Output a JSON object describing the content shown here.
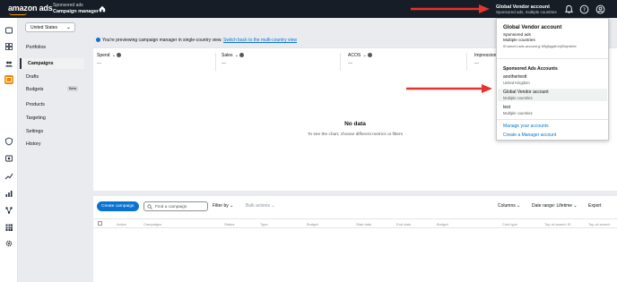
{
  "topbar": {
    "logo": "amazon ads",
    "product_sub": "Sponsored ads",
    "product_main": "Campaign manager",
    "account_name": "Global Vendor account",
    "account_meta": "Sponsored ads, multiple countries"
  },
  "country_selector": {
    "value": "United States"
  },
  "nav": {
    "items": [
      {
        "label": "Portfolios"
      },
      {
        "label": "Campaigns"
      },
      {
        "label": "Drafts"
      },
      {
        "label": "Budgets",
        "badge": "Beta"
      },
      {
        "label": "Products"
      },
      {
        "label": "Targeting"
      },
      {
        "label": "Settings"
      },
      {
        "label": "History"
      }
    ]
  },
  "banner": {
    "text": "You're previewing campaign manager in single-country view.",
    "link": "Switch back to the multi-country view"
  },
  "metrics": [
    {
      "label": "Spend",
      "value": "—"
    },
    {
      "label": "Sales",
      "value": "—"
    },
    {
      "label": "ACOS",
      "value": "—"
    },
    {
      "label": "Impressions",
      "value": "—"
    }
  ],
  "empty_state": {
    "title": "No data",
    "text": "To see the chart, choose different metrics or filters"
  },
  "table": {
    "create_button": "Create campaign",
    "search_placeholder": "Find a campaign",
    "filter_by": "Filter by",
    "bulk_actions": "Bulk actions",
    "columns": "Columns",
    "date_range": "Date range: Lifetime",
    "export": "Export",
    "headers": [
      "Active",
      "Campaigns",
      "Status",
      "Type",
      "Budget",
      "Start date",
      "End date",
      "Budget",
      "Cost type",
      "Top-of-search IS",
      "Top-of-search"
    ]
  },
  "account_popup": {
    "title": "Global Vendor account",
    "sub1": "Sponsored ads",
    "sub2": "Multiple countries",
    "account_id": "ID:amzn1.ads-account.g.1f8g6gqdh1xj50qmkfee",
    "section_heading": "Sponsored Ads Accounts",
    "accounts": [
      {
        "name": "anothertestt",
        "detail": "United Kingdom"
      },
      {
        "name": "Global Vendor account",
        "detail": "Multiple countries"
      },
      {
        "name": "test",
        "detail": "Multiple countries"
      }
    ],
    "manage_link": "Manage your accounts",
    "create_link": "Create a Manager account"
  },
  "colors": {
    "topbar": "#161d26",
    "accent": "#0972d3",
    "brand_orange": "#ff9900",
    "annotation_red": "#e3342f"
  }
}
